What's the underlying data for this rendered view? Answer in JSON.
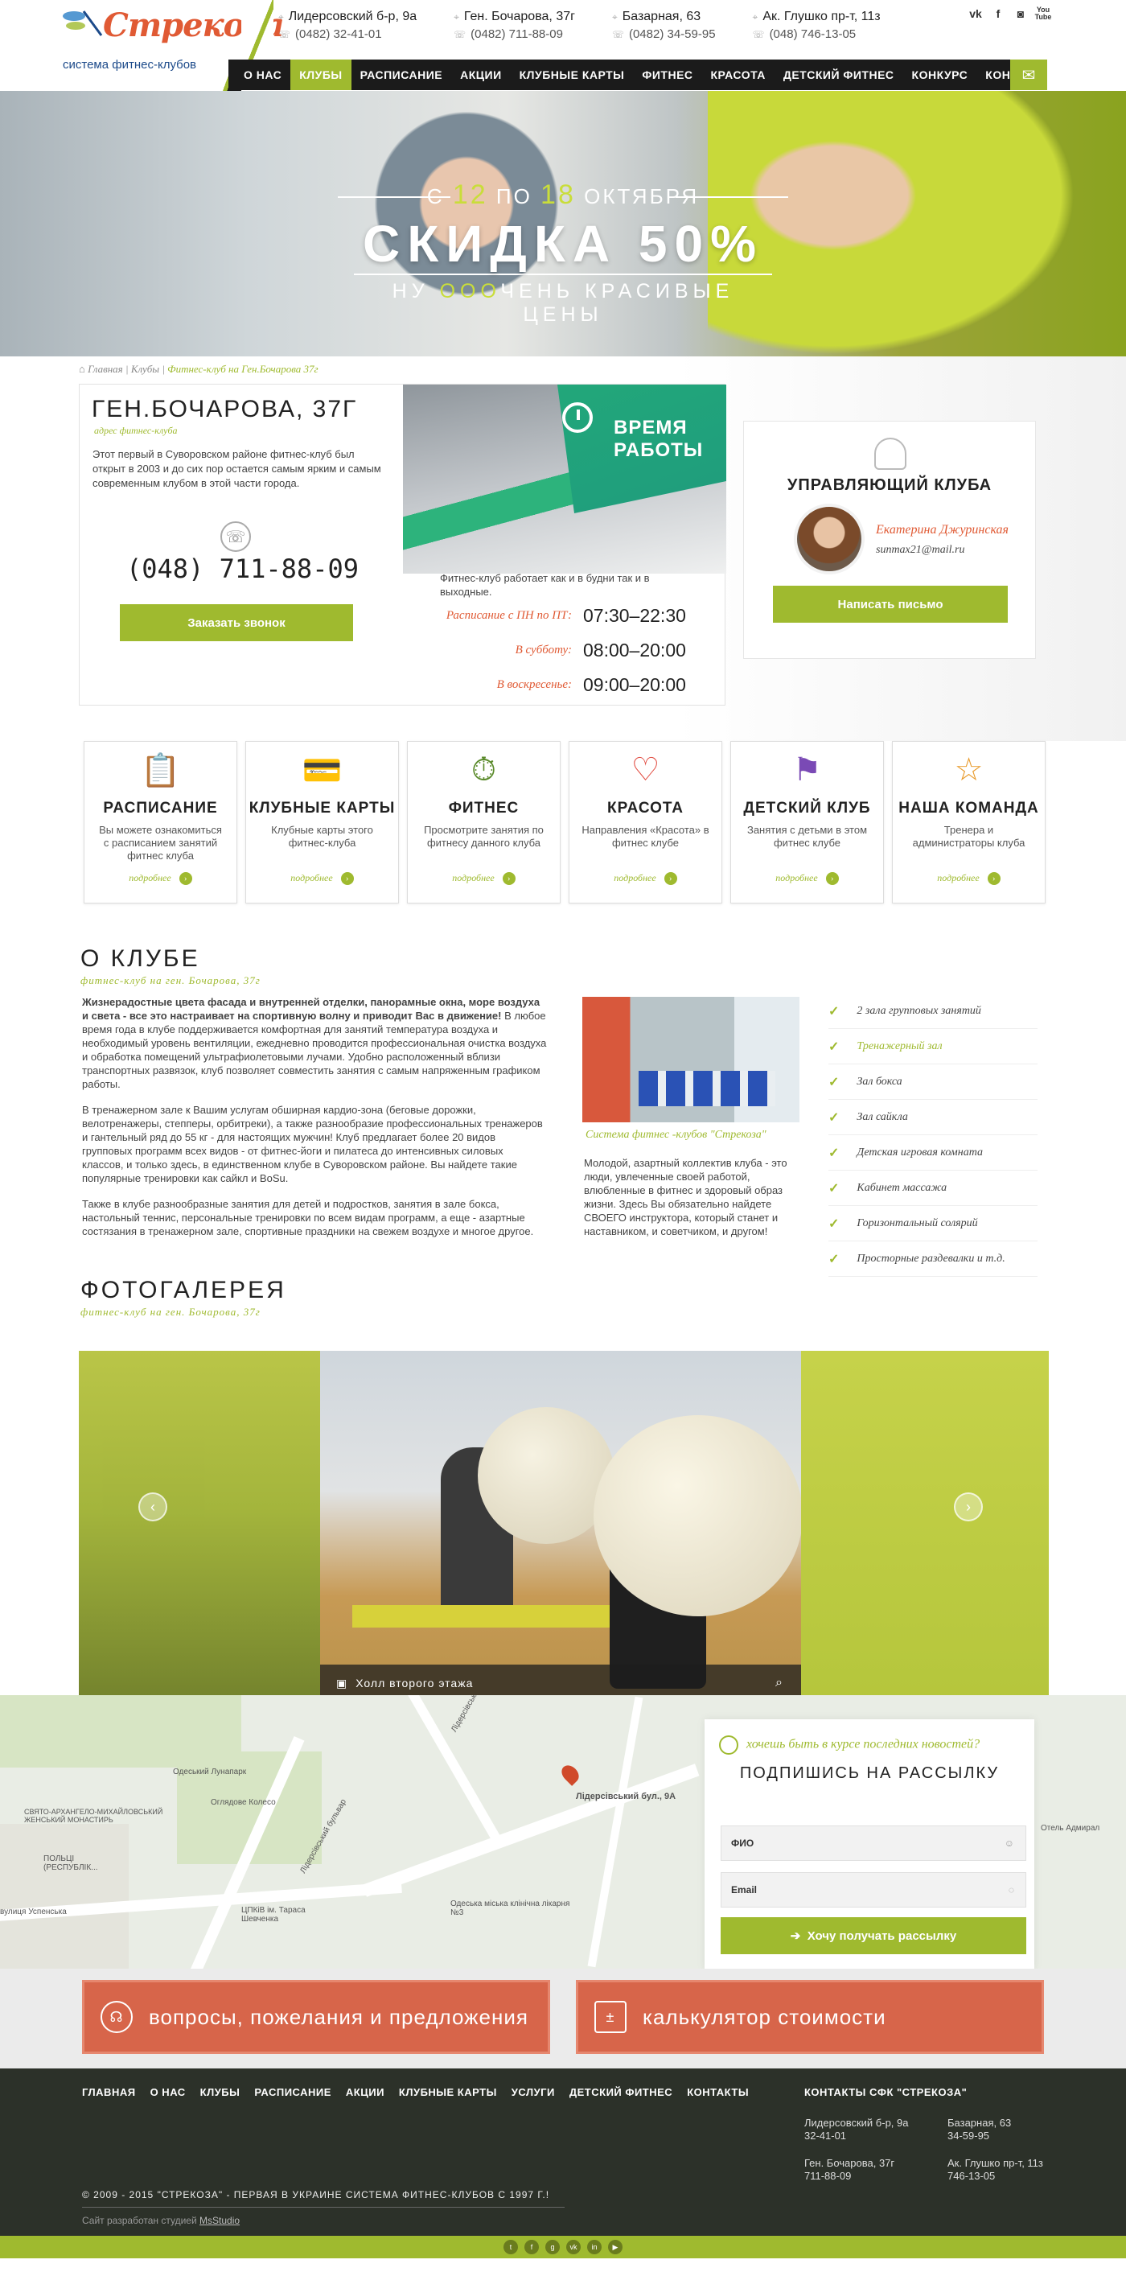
{
  "header": {
    "logo_title": "Стрекоза",
    "logo_sub": "система фитнес-клубов",
    "contacts": [
      {
        "addr": "Лидерсовский б-р, 9а",
        "phone": "(0482) 32-41-01"
      },
      {
        "addr": "Ген. Бочарова, 37г",
        "phone": "(0482) 711-88-09"
      },
      {
        "addr": "Базарная, 63",
        "phone": "(0482) 34-59-95"
      },
      {
        "addr": "Ак. Глушко пр-т, 11з",
        "phone": "(048) 746-13-05"
      }
    ],
    "social": [
      "vk",
      "f",
      "instagram",
      "You Tube"
    ]
  },
  "menu": [
    "О НАС",
    "КЛУБЫ",
    "РАСПИСАНИЕ",
    "АКЦИИ",
    "КЛУБНЫЕ КАРТЫ",
    "ФИТНЕС",
    "КРАСОТА",
    "ДЕТСКИЙ ФИТНЕС",
    "КОНКУРС",
    "КОНТАКТЫ"
  ],
  "menu_active": "КЛУБЫ",
  "hero": {
    "range_prefix": "С",
    "range_from": "12",
    "range_mid": "ПО",
    "range_to": "18",
    "range_month": "ОКТЯБРЯ",
    "headline": "СКИДКА 50%",
    "tag_prefix": "НУ",
    "tag_ooo": "ООО",
    "tag_rest": "ЧЕНЬ КРАСИВЫЕ ЦЕНЫ",
    "slides": 6,
    "active_slide": 6
  },
  "breadcrumb": [
    "Главная",
    "Клубы",
    "Фитнес-клуб на Ген.Бочарова 37г"
  ],
  "club": {
    "address": "ГЕН.БОЧАРОВА, 37Г",
    "address_sub": "адрес фитнес-клуба",
    "description": "Этот первый в Суворовском районе фитнес-клуб был открыт в 2003 и до сих пор остается самым ярким и самым современным клубом в этой части города.",
    "phone": "(048) 711-88-09",
    "callback_label": "Заказать звонок"
  },
  "hours": {
    "title": "ВРЕМЯ РАБОТЫ",
    "note": "Фитнес-клуб работает как и в будни так и в выходные.",
    "rows": [
      {
        "label": "Расписание с ПН по ПТ:",
        "value": "07:30–22:30"
      },
      {
        "label": "В субботу:",
        "value": "08:00–20:00"
      },
      {
        "label": "В воскресенье:",
        "value": "09:00–20:00"
      }
    ]
  },
  "manager": {
    "title": "УПРАВЛЯЮЩИЙ КЛУБА",
    "name": "Екатерина Джуринская",
    "email": "sunmax21@mail.ru",
    "button": "Написать письмо"
  },
  "services": [
    {
      "icon": "clipboard-icon",
      "title": "РАСПИСАНИЕ",
      "desc": "Вы можете ознакомиться с расписанием занятий фитнес клуба",
      "more": "подробнее",
      "color": "#e05a34"
    },
    {
      "icon": "card-icon",
      "title": "КЛУБНЫЕ КАРТЫ",
      "desc": "Клубные карты этого фитнес-клуба",
      "more": "подробнее",
      "color": "#2a7fc7"
    },
    {
      "icon": "stopwatch-icon",
      "title": "ФИТНЕС",
      "desc": "Просмотрите занятия по фитнесу данного клуба",
      "more": "подробнее",
      "color": "#5a8a2a"
    },
    {
      "icon": "heartbeat-icon",
      "title": "КРАСОТА",
      "desc": "Направления «Красота» в фитнес клубе",
      "more": "подробнее",
      "color": "#e0453a"
    },
    {
      "icon": "kids-icon",
      "title": "ДЕТСКИЙ КЛУБ",
      "desc": "Занятия с детьми в этом фитнес клубе",
      "more": "подробнее",
      "color": "#7a4ab5"
    },
    {
      "icon": "star-icon",
      "title": "НАША КОМАНДА",
      "desc": "Тренера и администраторы клуба",
      "more": "подробнее",
      "color": "#e89a2a"
    }
  ],
  "about": {
    "title": "О КЛУБЕ",
    "sub": "фитнес-клуб на ген. Бочарова, 37г",
    "p1_bold": "Жизнерадостные цвета фасада и внутренней отделки, панорамные окна, море воздуха и света - все это настраивает на спортивную волну и приводит Вас в движение!",
    "p1": " В любое время года в клубе поддерживается комфортная для занятий температура воздуха и необходимый уровень вентиляции, ежедневно проводится профессиональная очистка воздуха и обработка помещений ультрафиолетовыми лучами. Удобно расположенный вблизи транспортных развязок, клуб позволяет совместить занятия с самым напряженным графиком работы.",
    "p2": "В тренажерном зале к Вашим услугам обширная кардио-зона (беговые дорожки, велотренажеры, степперы, орбитреки), а также разнообразие профессиональных тренажеров и гантельный ряд до 55 кг - для настоящих мужчин! Клуб предлагает более 20 видов групповых программ всех видов - от фитнес-йоги и пилатеса до интенсивных силовых классов, и только здесь, в единственном клубе в Суворовском районе. Вы найдете такие популярные тренировки как сайкл и BoSu.",
    "p3": "Также в клубе разнообразные занятия для детей и подростков, занятия в зале бокса, настольный теннис, персональные тренировки по всем видам программ, а еще - азартные состязания в тренажерном зале, спортивные праздники на свежем воздухе и многое другое.",
    "photo_caption": "Система фитнес -клубов \"Стрекоза\"",
    "quote": "Молодой, азартный коллектив клуба - это люди, увлеченные своей работой, влюбленные в фитнес и здоровый образ жизни. Здесь Вы обязательно найдете СВОЕГО инструктора, который станет и наставником, и советчиком, и другом!",
    "features": [
      "2 зала групповых занятий",
      "Тренажерный зал",
      "Зал бокса",
      "Зал сайкла",
      "Детская игровая комната",
      "Кабинет массажа",
      "Горизонтальный солярий",
      "Просторные раздевалки и т.д."
    ],
    "feature_highlight": "Тренажерный зал"
  },
  "gallery": {
    "title": "ФОТОГАЛЕРЕЯ",
    "sub": "фитнес-клуб на ген. Бочарова, 37г",
    "caption": "Холл второго этажа"
  },
  "map": {
    "labels": [
      "Одеський Лунапарк",
      "Оглядове Колесо",
      "СВЯТО-АРХАНГЕЛО-МИХАЙЛОВСЬКИЙ ЖЕНСЬКИЙ МОНАСТИРЬ",
      "ПОЛЬЦІ (РЕСПУБЛІК...",
      "ЦПКіВ ім. Тараса Шевченка",
      "вулиця Успенська",
      "Лідерсівський бульвар",
      "Одеська міська клінічна лікарня №3",
      "Лідерсівський бул., 9А",
      "Лідерсівський",
      "Отель Адмирал"
    ]
  },
  "subscribe": {
    "question": "хочешь быть в курсе последних новостей?",
    "title": "ПОДПИШИСЬ НА РАССЫЛКУ",
    "name_placeholder": "ФИО",
    "email_placeholder": "Email",
    "button": "Хочу получать рассылку"
  },
  "ctas": [
    "вопросы, пожелания и предложения",
    "калькулятор стоимости"
  ],
  "footer": {
    "menu": [
      "ГЛАВНАЯ",
      "О НАС",
      "КЛУБЫ",
      "РАСПИСАНИЕ",
      "АКЦИИ",
      "КЛУБНЫЕ КАРТЫ",
      "УСЛУГИ",
      "ДЕТСКИЙ ФИТНЕС",
      "КОНТАКТЫ"
    ],
    "contacts_title": "КОНТАКТЫ СФК \"СТРЕКОЗА\"",
    "contacts": [
      {
        "addr": "Лидерсовский б-р, 9а",
        "phone": "32-41-01"
      },
      {
        "addr": "Базарная, 63",
        "phone": "34-59-95"
      },
      {
        "addr": "Ген. Бочарова, 37г",
        "phone": "711-88-09"
      },
      {
        "addr": "Ак. Глушко пр-т, 11з",
        "phone": "746-13-05"
      }
    ],
    "copyright": "© 2009 - 2015 \"СТРЕКОЗА\" - ПЕРВАЯ В УКРАИНЕ СИСТЕМА ФИТНЕС-КЛУБОВ С 1997 Г.!",
    "dev_prefix": "Сайт разработан студией",
    "dev_name": "MsStudio",
    "social": [
      "twitter",
      "facebook",
      "google",
      "vk",
      "linkedin",
      "youtube"
    ]
  },
  "colors": {
    "accent": "#9fba2f",
    "orange": "#e05a34",
    "dark": "#1b1b1b"
  }
}
